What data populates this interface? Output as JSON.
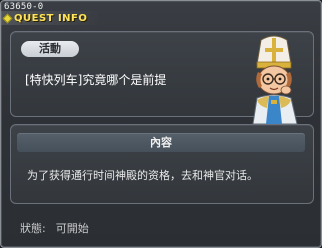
{
  "window": {
    "id_label": "63650-0",
    "title": "QUEST INFO"
  },
  "quest": {
    "category": "活動",
    "name": "[特快列车]究竟哪个是前提"
  },
  "npc": {
    "icon": "priest-npc-portrait"
  },
  "content": {
    "header": "內容",
    "text": "为了获得通行时间神殿的资格，去和神官对话。"
  },
  "status": {
    "label": "狀態:",
    "value": "可開始"
  },
  "colors": {
    "title": "#ffe45a",
    "panel_border": "#6b717a",
    "background": "#2f3338"
  }
}
